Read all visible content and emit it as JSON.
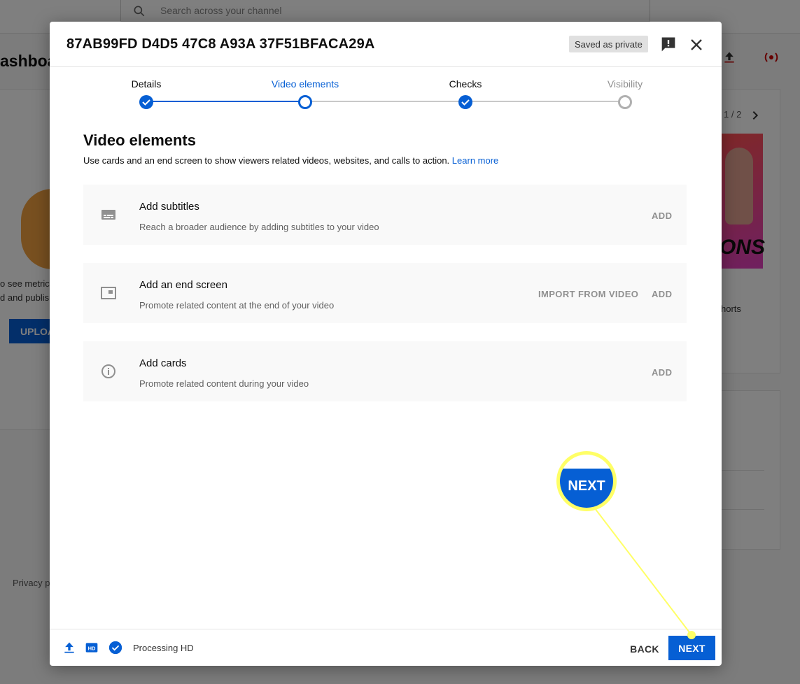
{
  "background": {
    "search_placeholder": "Search across your channel",
    "dashboard_title": "ashboa",
    "left_text_1": "o see metric",
    "left_text_2": "d and publish",
    "upload_label": "UPLOA",
    "privacy_text": "Privacy p",
    "pager": "1 / 2",
    "thumb_text": "ONS",
    "shorts_text": "horts"
  },
  "dialog": {
    "title": "87AB99FD D4D5 47C8 A93A 37F51BFACA29A",
    "saved_chip": "Saved as private",
    "steps": [
      {
        "label": "Details",
        "state": "done"
      },
      {
        "label": "Video elements",
        "state": "current"
      },
      {
        "label": "Checks",
        "state": "done"
      },
      {
        "label": "Visibility",
        "state": "pending"
      }
    ],
    "section_title": "Video elements",
    "section_desc": "Use cards and an end screen to show viewers related videos, websites, and calls to action.",
    "learn_more": "Learn more",
    "elements": [
      {
        "icon": "subtitles-icon",
        "name": "Add subtitles",
        "desc": "Reach a broader audience by adding subtitles to your video",
        "action": "ADD"
      },
      {
        "icon": "end-screen-icon",
        "name": "Add an end screen",
        "desc": "Promote related content at the end of your video",
        "import": "IMPORT FROM VIDEO",
        "action": "ADD"
      },
      {
        "icon": "info-icon",
        "name": "Add cards",
        "desc": "Promote related content during your video",
        "action": "ADD"
      }
    ],
    "footer": {
      "processing_text": "Processing HD",
      "back_label": "BACK",
      "next_label": "NEXT"
    }
  },
  "callout": {
    "label": "NEXT"
  },
  "colors": {
    "accent": "#065fd4",
    "callout": "#ffff66",
    "overlay": "rgba(0,0,0,0.5)"
  }
}
